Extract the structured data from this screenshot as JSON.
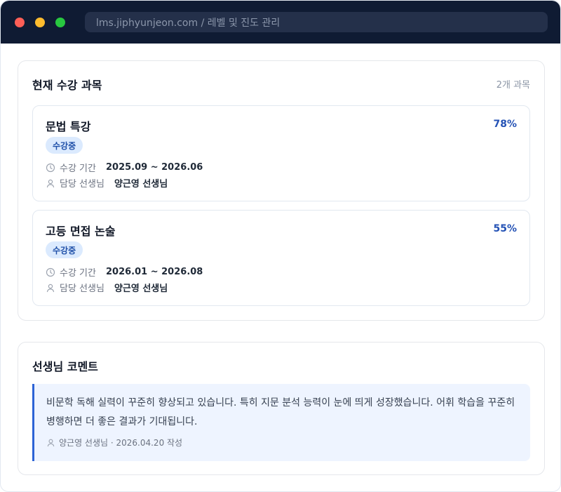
{
  "window": {
    "url": "lms.jiphyunjeon.com / 레벨 및 진도 관리"
  },
  "courses_card": {
    "title": "현재 수강 과목",
    "count": "2개 과목",
    "courses": [
      {
        "name": "문법 특강",
        "percent": "78%",
        "status": "수강중",
        "period_label": "수강 기간",
        "period": "2025.09 ~ 2026.06",
        "teacher_label": "담당 선생님",
        "teacher": "양근영 선생님"
      },
      {
        "name": "고등 면접 논술",
        "percent": "55%",
        "status": "수강중",
        "period_label": "수강 기간",
        "period": "2026.01 ~ 2026.08",
        "teacher_label": "담당 선생님",
        "teacher": "양근영 선생님"
      }
    ]
  },
  "comments_card": {
    "title": "선생님 코멘트",
    "comment": {
      "text": "비문학 독해 실력이 꾸준히 향상되고 있습니다. 특히 지문 분석 능력이 눈에 띄게 성장했습니다. 어휘 학습을 꾸준히 병행하면 더 좋은 결과가 기대됩니다.",
      "meta": "양근영 선생님 · 2026.04.20 작성"
    }
  },
  "icons": {
    "clock": "clock-icon",
    "user": "user-icon"
  },
  "colors": {
    "titlebar": "#0f1b33",
    "accent": "#2452b5",
    "badge_bg": "#dbeafe",
    "comment_bg": "#eef4ff",
    "comment_border": "#2d63d5"
  }
}
